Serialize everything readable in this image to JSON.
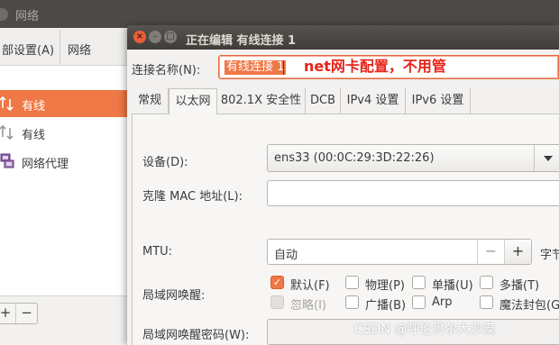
{
  "bg_window": {
    "title": "网络",
    "toolbar": {
      "item_left": "部设置(A)",
      "item_right": "网络"
    },
    "sidebar": [
      {
        "label": "有线",
        "icon": "wired-network-icon",
        "selected": true
      },
      {
        "label": "有线",
        "icon": "wired-network-icon",
        "selected": false
      },
      {
        "label": "网络代理",
        "icon": "network-proxy-icon",
        "selected": false
      }
    ],
    "add_label": "+",
    "remove_label": "−"
  },
  "dialog": {
    "title": "正在编辑 有线连接 1",
    "connection_name_label": "连接名称(N):",
    "connection_name_value": "有线连接 1",
    "annotation": "net网卡配置，不用管",
    "tabs": [
      "常规",
      "以太网",
      "802.1X 安全性",
      "DCB",
      "IPv4 设置",
      "IPv6 设置"
    ],
    "active_tab": "以太网",
    "fields": {
      "device_label": "设备(D):",
      "device_value": "ens33 (00:0C:29:3D:22:26)",
      "clone_mac_label": "克隆 MAC 地址(L):",
      "clone_mac_value": "",
      "mtu_label": "MTU:",
      "mtu_value": "自动",
      "mtu_minus": "−",
      "mtu_plus": "+",
      "mtu_unit": "字节",
      "wol_label": "局域网唤醒:",
      "wol_password_label": "局域网唤醒密码(W):",
      "wol_password_value": ""
    },
    "wol_options": [
      {
        "label": "默认(F)",
        "checked": true,
        "disabled": false
      },
      {
        "label": "物理(P)",
        "checked": false,
        "disabled": false
      },
      {
        "label": "单播(U)",
        "checked": false,
        "disabled": false
      },
      {
        "label": "多播(T)",
        "checked": false,
        "disabled": false
      },
      {
        "label": "忽略(I)",
        "checked": false,
        "disabled": true
      },
      {
        "label": "广播(B)",
        "checked": false,
        "disabled": false
      },
      {
        "label": "Arp",
        "checked": false,
        "disabled": false
      },
      {
        "label": "魔法封包(G)",
        "checked": false,
        "disabled": false
      }
    ]
  },
  "watermark": "CSDN @呼伦贝尔大沙漠",
  "colors": {
    "accent": "#f07746",
    "annotation": "#e8231a",
    "titlebar": "#4c4a46"
  }
}
